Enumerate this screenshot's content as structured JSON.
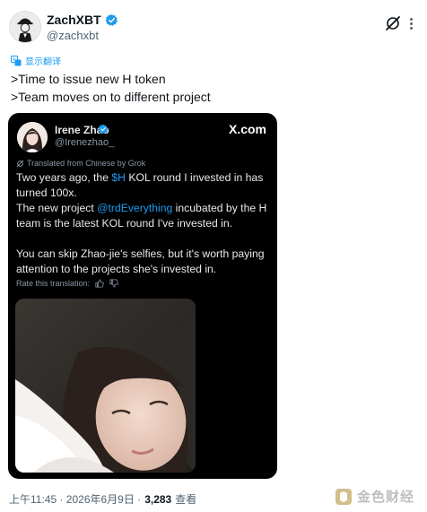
{
  "author": {
    "name": "ZachXBT",
    "handle": "@zachxbt",
    "avatar_icon": "detective-avatar",
    "verified_color": "#1d9bf0"
  },
  "translate_label": "显示翻译",
  "tweet_lines": [
    ">Time to issue new H token",
    ">Team moves on to different project"
  ],
  "quoted": {
    "name": "Irene Zhao",
    "handle": "@Irenezhao_",
    "source": "X.com",
    "grok_note": "Translated from Chinese by Grok",
    "text": {
      "l1_a": "Two years ago, the ",
      "l1_link": "$H",
      "l1_b": " KOL round I invested in has",
      "l2": "turned 100x.",
      "l3_a": "The new project ",
      "l3_link": "@trdEverything",
      "l3_b": " incubated by the H",
      "l4": "team is the latest KOL round I've invested in.",
      "l5": "You can skip Zhao-jie's selfies, but it's worth paying",
      "l6": "attention to the projects she's invested in."
    },
    "rate_label": "Rate this translation:"
  },
  "footer": {
    "time": "上午11:45 · 2026年6月9日 · ",
    "views": "3,283",
    "views_label": "查看"
  },
  "watermark": "金色财经",
  "colors": {
    "accent": "#1d9bf0",
    "card_bg": "#000000",
    "text": "#0f1419",
    "muted": "#536471"
  }
}
